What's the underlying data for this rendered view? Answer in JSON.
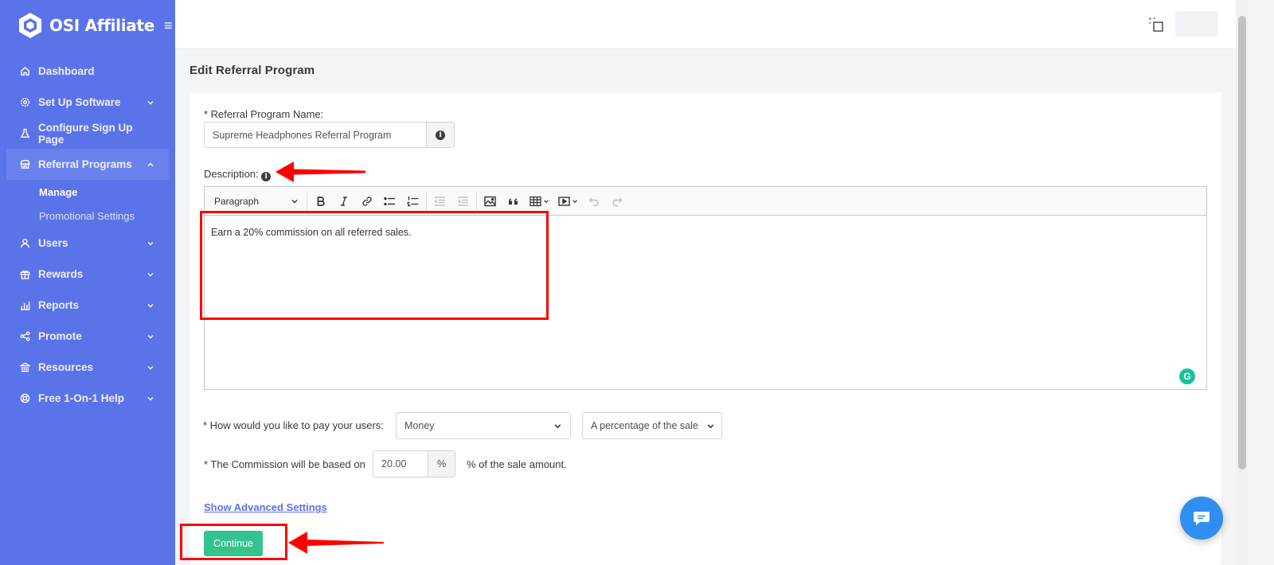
{
  "brand": {
    "name": "OSI Affiliate"
  },
  "sidebar": {
    "items": [
      {
        "label": "Dashboard",
        "icon": "home-icon",
        "has_chevron": false
      },
      {
        "label": "Set Up Software",
        "icon": "gear-icon",
        "has_chevron": true
      },
      {
        "label": "Configure Sign Up Page",
        "icon": "flask-icon",
        "has_chevron": false
      },
      {
        "label": "Referral Programs",
        "icon": "store-icon",
        "has_chevron": true,
        "active": true
      },
      {
        "label": "Users",
        "icon": "user-icon",
        "has_chevron": true
      },
      {
        "label": "Rewards",
        "icon": "gift-icon",
        "has_chevron": true
      },
      {
        "label": "Reports",
        "icon": "bar-chart-icon",
        "has_chevron": true
      },
      {
        "label": "Promote",
        "icon": "share-icon",
        "has_chevron": true
      },
      {
        "label": "Resources",
        "icon": "bank-icon",
        "has_chevron": true
      },
      {
        "label": "Free 1-On-1 Help",
        "icon": "lifebuoy-icon",
        "has_chevron": true
      }
    ],
    "subitems": [
      {
        "label": "Manage",
        "current": true
      },
      {
        "label": "Promotional Settings",
        "current": false
      }
    ]
  },
  "page": {
    "title": "Edit Referral Program"
  },
  "form": {
    "program_name_label": "* Referral Program Name:",
    "program_name_value": "Supreme Headphones Referral Program",
    "description_label": "Description:",
    "editor": {
      "format_select": "Paragraph",
      "content": "Earn a 20% commission on all referred sales."
    },
    "pay_label": "* How would you like to pay your users:",
    "pay_method": "Money",
    "pay_basis": "A percentage of the sale",
    "commission_label": "* The Commission will be based on",
    "commission_value": "20.00",
    "commission_unit": "%",
    "commission_suffix": "% of the sale amount.",
    "advanced_link": "Show Advanced Settings",
    "continue_button": "Continue"
  },
  "colors": {
    "sidebar": "#5b73e8",
    "accent_green": "#34c38f",
    "annotation_red": "#ff0000",
    "chat": "#2e8ef2"
  }
}
